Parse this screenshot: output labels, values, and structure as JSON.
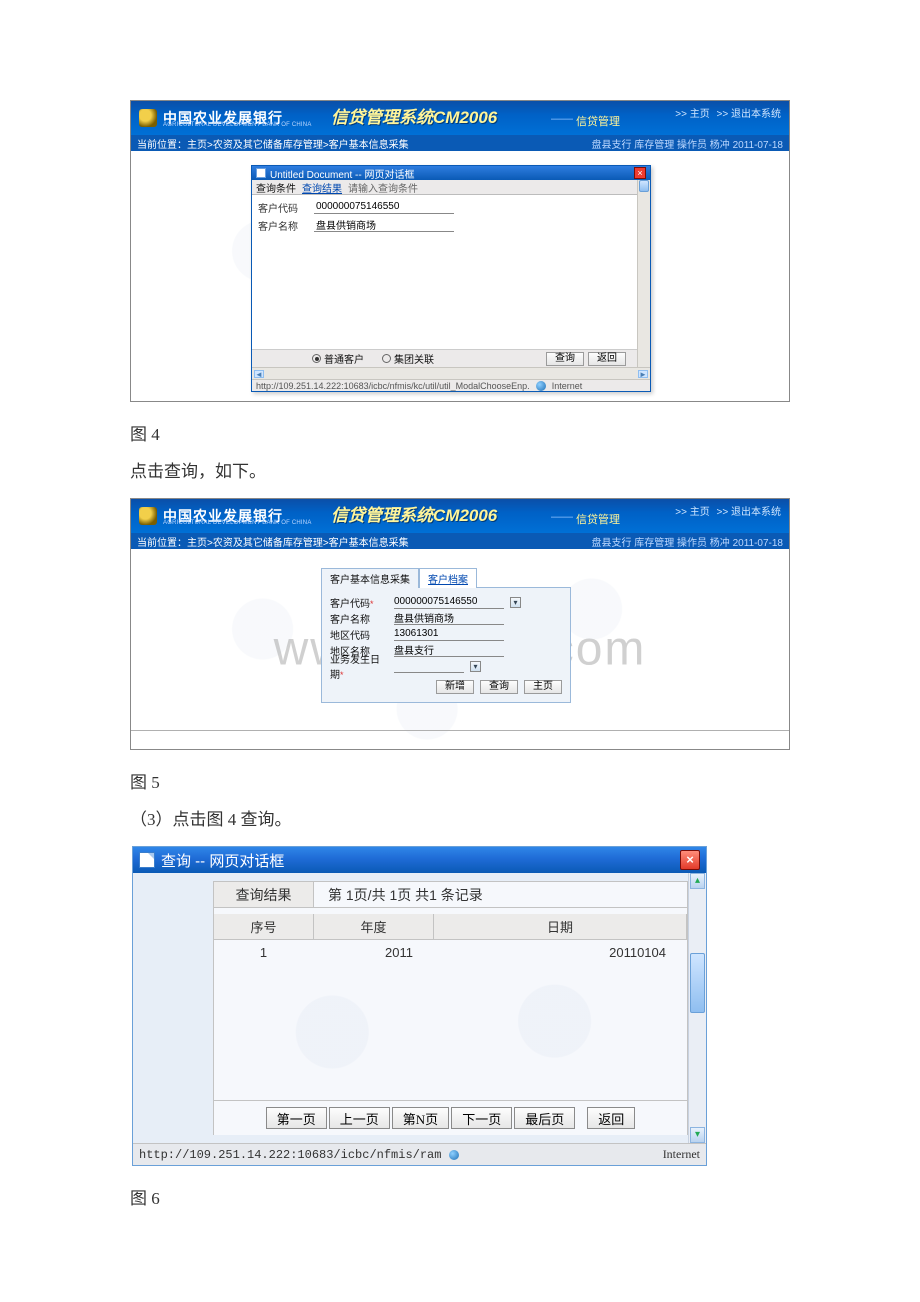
{
  "captions": {
    "fig4": "图 4",
    "fig5": "图 5",
    "fig6": "图 6"
  },
  "body_text": {
    "after4": "点击查询，如下。",
    "after5": "（3）点击图 4 查询。"
  },
  "app": {
    "bank_name": "中国农业发展银行",
    "bank_sub": "AGRICULTURAL DEVELOPMENT BANK OF CHINA",
    "title": "信贷管理系统CM2006",
    "dash": "——",
    "subtitle": "信贷管理",
    "top_links": {
      "home": ">> 主页",
      "logout": ">> 退出本系统"
    },
    "breadcrumb": "当前位置：主页>农资及其它储备库存管理>客户基本信息采集",
    "right_status": "盘县支行 库存管理 操作员 杨冲 2011-07-18"
  },
  "modal4": {
    "title": "Untitled Document -- 网页对话框",
    "toolbar": {
      "label": "查询条件",
      "link": "查询结果",
      "hint": "请输入查询条件"
    },
    "rows": {
      "code_label": "客户代码",
      "code_value": "000000075146550",
      "name_label": "客户名称",
      "name_value": "盘县供销商场"
    },
    "radios": {
      "normal": "普通客户",
      "group": "集团关联"
    },
    "buttons": {
      "query": "查询",
      "back": "返回"
    },
    "status_url": "http://109.251.14.222:10683/icbc/nfmis/kc/util/util_ModalChooseEnp.",
    "status_zone": "Internet"
  },
  "panel5": {
    "tab_active": "客户基本信息采集",
    "tab_inactive": "客户档案",
    "rows": {
      "code_label": "客户代码",
      "code_value": "000000075146550",
      "name_label": "客户名称",
      "name_value": "盘县供销商场",
      "area_code_label": "地区代码",
      "area_code_value": "13061301",
      "area_name_label": "地区名称",
      "area_name_value": "盘县支行",
      "date_label": "业务发生日期",
      "date_value": ""
    },
    "buttons": {
      "add": "新增",
      "query": "查询",
      "home": "主页"
    }
  },
  "dlg6": {
    "title": "查询 -- 网页对话框",
    "result_tab": "查询结果",
    "result_info": "第 1页/共 1页 共1 条记录",
    "cols": {
      "no": "序号",
      "year": "年度",
      "date": "日期"
    },
    "row": {
      "no": "1",
      "year": "2011",
      "date": "20110104"
    },
    "pager": {
      "first": "第一页",
      "prev": "上一页",
      "nth": "第N页",
      "next": "下一页",
      "last": "最后页",
      "back": "返回"
    },
    "status_url": "http://109.251.14.222:10683/icbc/nfmis/ram",
    "status_zone": "Internet"
  },
  "watermark": "www.bdocx.com"
}
